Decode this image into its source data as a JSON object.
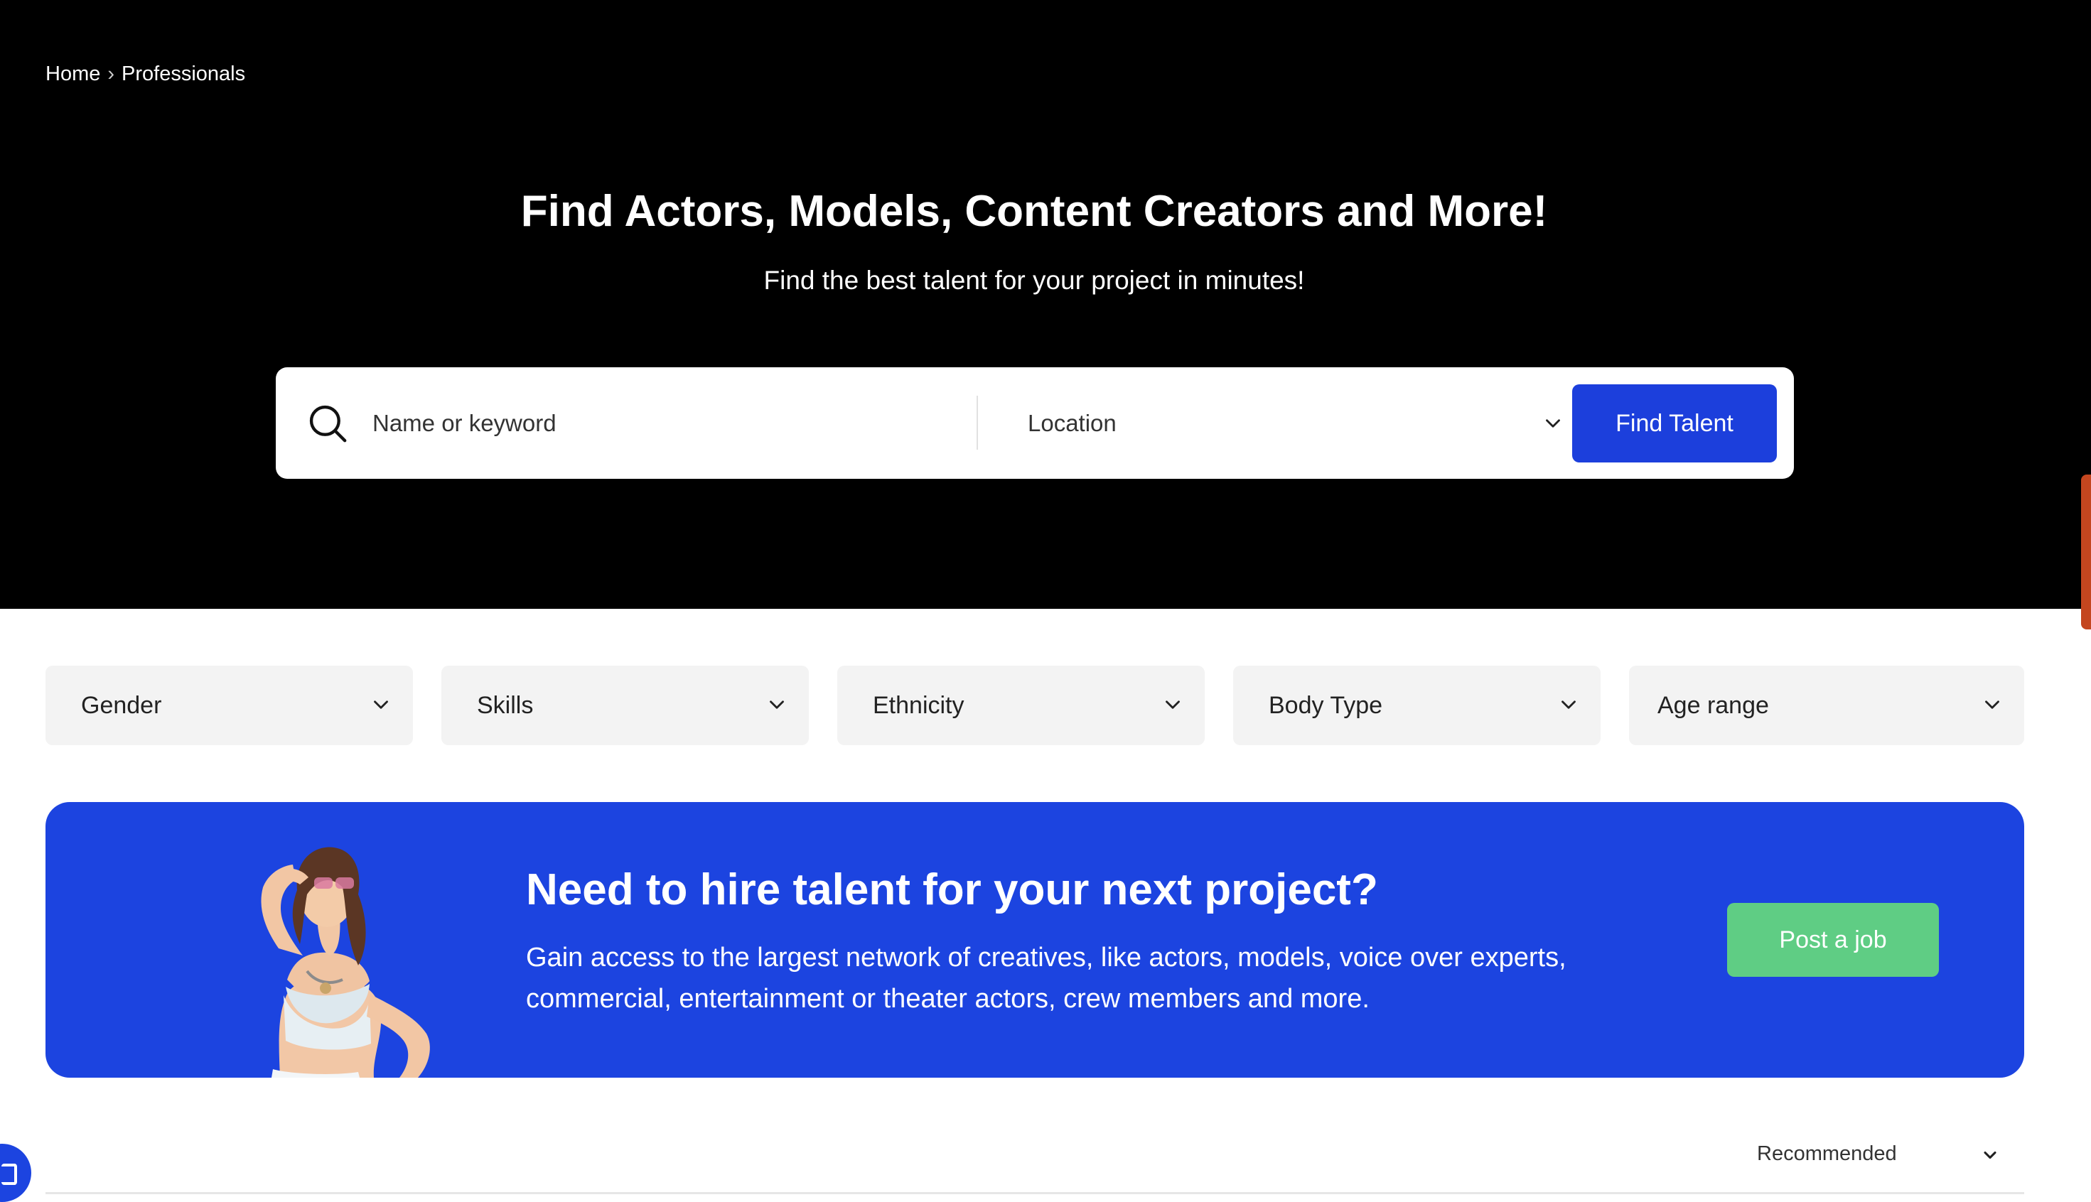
{
  "breadcrumb": {
    "home": "Home",
    "separator": "›",
    "current": "Professionals"
  },
  "hero": {
    "title": "Find Actors, Models, Content Creators and More!",
    "subtitle": "Find the best talent for your project in minutes!"
  },
  "search": {
    "placeholder": "Name or keyword",
    "location_label": "Location",
    "button_label": "Find Talent"
  },
  "filters": [
    {
      "label": "Gender"
    },
    {
      "label": "Skills"
    },
    {
      "label": "Ethnicity"
    },
    {
      "label": "Body Type"
    },
    {
      "label": "Age range"
    }
  ],
  "banner": {
    "title": "Need to hire talent for your next project?",
    "description": "Gain access to the largest network of creatives, like actors, models, voice over experts, commercial, entertainment or theater actors, crew members and more.",
    "button_label": "Post a job"
  },
  "sort": {
    "selected": "Recommended"
  },
  "colors": {
    "hero_bg": "#000000",
    "accent": "#1c3fdc",
    "banner_bg": "#1c44e0",
    "post_button": "#5fcd84",
    "filter_bg": "#f3f3f3",
    "side_accent": "#c4461f"
  },
  "icons": {
    "search": "search-icon",
    "dropdown": "chevron-down-icon",
    "chat": "chat-icon"
  }
}
